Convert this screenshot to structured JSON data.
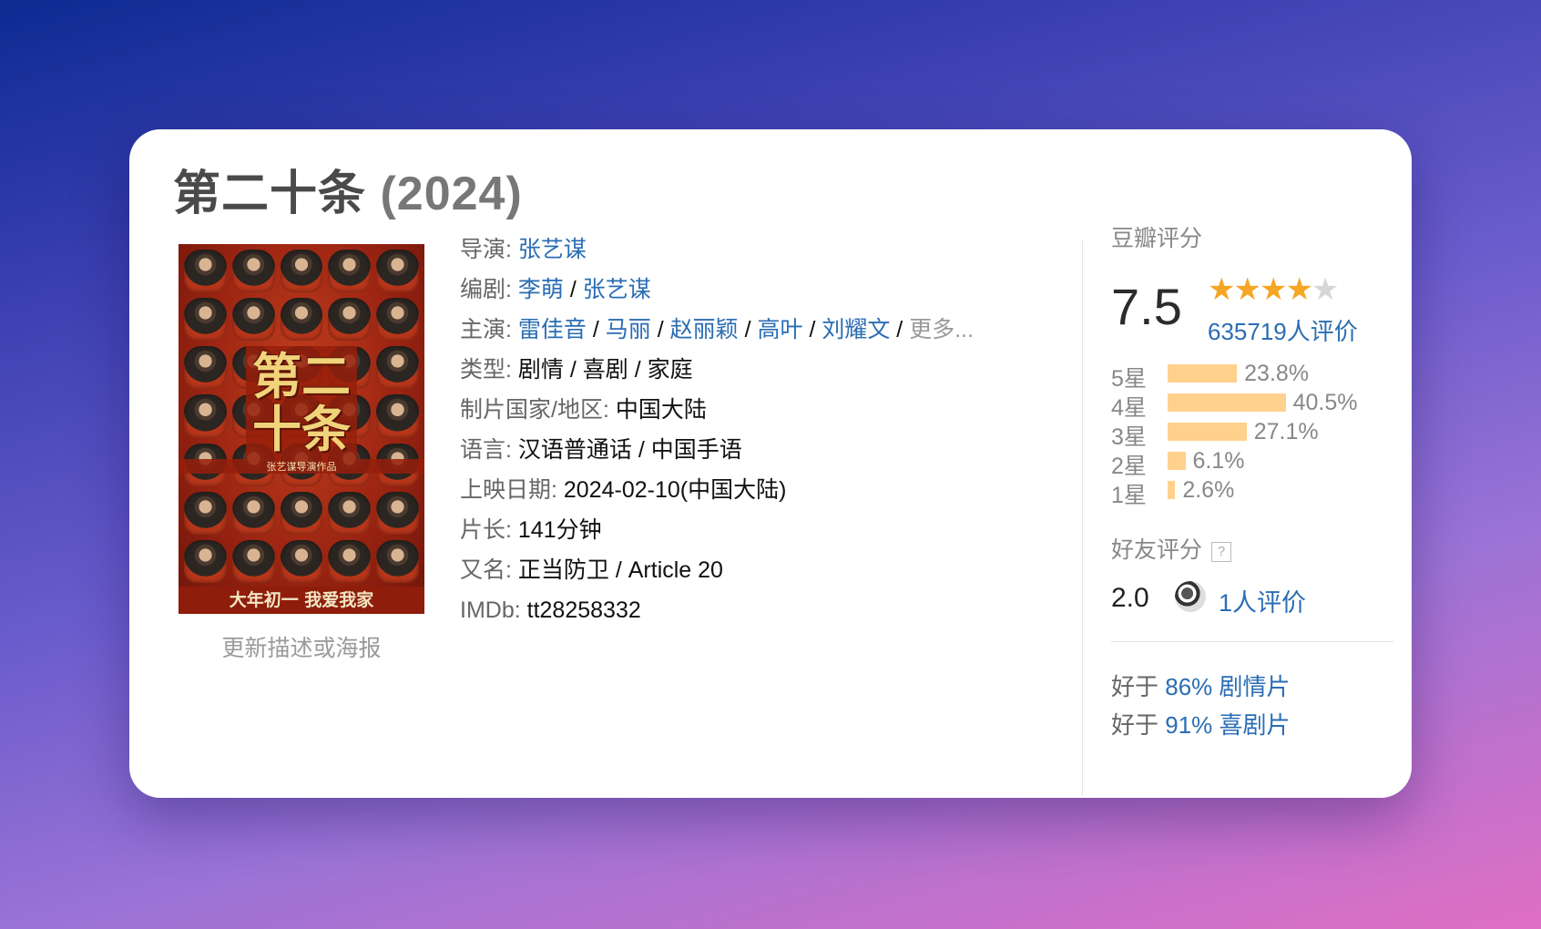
{
  "movie": {
    "title": "第二十条",
    "year": "(2024)"
  },
  "poster": {
    "title_text": "第二十条",
    "sub_text": "张艺谋导演作品",
    "tagline": "大年初一 我爱我家"
  },
  "update_link": "更新描述或海报",
  "info": {
    "director": {
      "label": "导演:",
      "names": [
        "张艺谋"
      ]
    },
    "writers": {
      "label": "编剧:",
      "names": [
        "李萌",
        "张艺谋"
      ]
    },
    "cast": {
      "label": "主演:",
      "names": [
        "雷佳音",
        "马丽",
        "赵丽颖",
        "高叶",
        "刘耀文"
      ],
      "more": "更多..."
    },
    "genre": {
      "label": "类型:",
      "value": "剧情 / 喜剧 / 家庭"
    },
    "country": {
      "label": "制片国家/地区:",
      "value": "中国大陆"
    },
    "language": {
      "label": "语言:",
      "value": "汉语普通话 / 中国手语"
    },
    "release": {
      "label": "上映日期:",
      "value": "2024-02-10(中国大陆)"
    },
    "runtime": {
      "label": "片长:",
      "value": "141分钟"
    },
    "aka": {
      "label": "又名:",
      "value": "正当防卫 / Article 20"
    },
    "imdb": {
      "label": "IMDb:",
      "value": "tt28258332"
    }
  },
  "rating": {
    "header": "豆瓣评分",
    "score": "7.5",
    "stars_value": 4,
    "stars_max": 5,
    "count": "635719人评价",
    "distribution": [
      {
        "label": "5星",
        "percent": 23.8,
        "text": "23.8%"
      },
      {
        "label": "4星",
        "percent": 40.5,
        "text": "40.5%"
      },
      {
        "label": "3星",
        "percent": 27.1,
        "text": "27.1%"
      },
      {
        "label": "2星",
        "percent": 6.1,
        "text": "6.1%"
      },
      {
        "label": "1星",
        "percent": 2.6,
        "text": "2.6%"
      }
    ],
    "friends": {
      "header": "好友评分",
      "help_icon": "?",
      "score": "2.0",
      "count": "1人评价"
    },
    "better_than": [
      {
        "prefix": "好于",
        "link": "86% 剧情片"
      },
      {
        "prefix": "好于",
        "link": "91% 喜剧片"
      }
    ]
  },
  "colors": {
    "link": "#2a6db4",
    "star": "#f5a623",
    "bar": "#ffd18d"
  }
}
